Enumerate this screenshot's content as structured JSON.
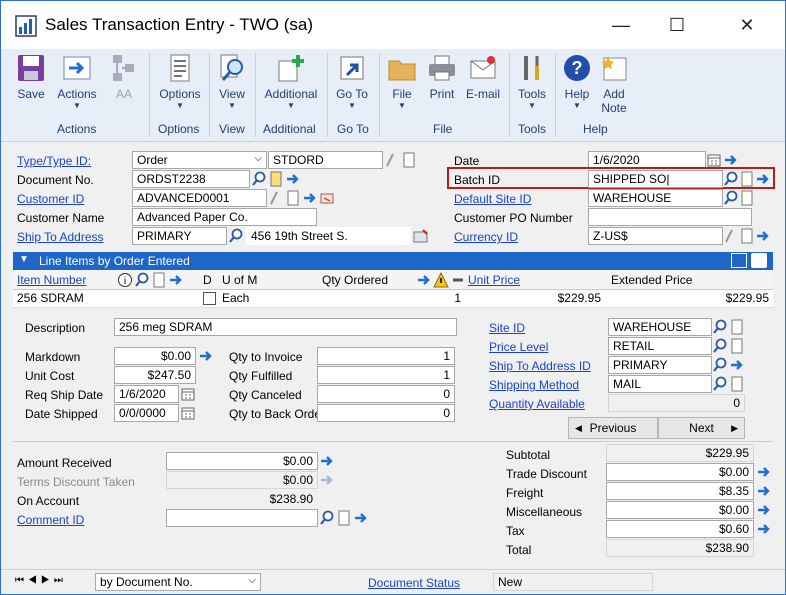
{
  "window": {
    "title": "Sales Transaction Entry  -  TWO (sa)",
    "minimize": "—",
    "maximize": "☐",
    "close": "✕"
  },
  "ribbon": {
    "buttons": [
      {
        "label": "Save",
        "icon": "save-icon"
      },
      {
        "label": "Actions",
        "icon": "actions-icon"
      },
      {
        "label": "AA",
        "icon": "aa-icon"
      },
      {
        "label": "Options",
        "icon": "options-icon"
      },
      {
        "label": "View",
        "icon": "view-icon"
      },
      {
        "label": "Additional",
        "icon": "additional-icon"
      },
      {
        "label": "Go To",
        "icon": "goto-icon"
      },
      {
        "label": "File",
        "icon": "file-icon"
      },
      {
        "label": "Print",
        "icon": "print-icon"
      },
      {
        "label": "E-mail",
        "icon": "email-icon"
      },
      {
        "label": "Tools",
        "icon": "tools-icon"
      },
      {
        "label": "Help",
        "icon": "help-icon"
      },
      {
        "label": "Add Note",
        "icon": "note-icon"
      }
    ],
    "groups": [
      "Actions",
      "Options",
      "View",
      "Additional",
      "Go To",
      "File",
      "Tools",
      "Help"
    ]
  },
  "header": {
    "type_label": "Type/Type ID:",
    "type_value": "Order",
    "type_id": "STDORD",
    "docno_label": "Document No.",
    "docno_value": "ORDST2238",
    "custid_label": "Customer ID",
    "custid_value": "ADVANCED0001",
    "custname_label": "Customer Name",
    "custname_value": "Advanced Paper Co.",
    "shipto_label": "Ship To Address",
    "shipto_value": "PRIMARY",
    "shipto_addr": "456 19th Street S.",
    "date_label": "Date",
    "date_value": "1/6/2020",
    "batch_label": "Batch ID",
    "batch_value": "SHIPPED SO|",
    "site_label": "Default Site ID",
    "site_value": "WAREHOUSE",
    "po_label": "Customer PO Number",
    "po_value": "",
    "currency_label": "Currency ID",
    "currency_value": "Z-US$"
  },
  "grid": {
    "title": "Line Items by Order Entered",
    "columns": {
      "item": "Item Number",
      "d": "D",
      "uom": "U of M",
      "qty": "Qty Ordered",
      "unit": "Unit Price",
      "ext": "Extended Price"
    },
    "row": {
      "item": "256 SDRAM",
      "uom": "Each",
      "qty": "1",
      "unit": "$229.95",
      "ext": "$229.95"
    }
  },
  "detail": {
    "desc_label": "Description",
    "desc_value": "256 meg SDRAM",
    "markdown_label": "Markdown",
    "markdown_value": "$0.00",
    "unitcost_label": "Unit Cost",
    "unitcost_value": "$247.50",
    "reqship_label": "Req Ship Date",
    "reqship_value": "1/6/2020",
    "dateship_label": "Date Shipped",
    "dateship_value": "0/0/0000",
    "qinv_label": "Qty to Invoice",
    "qinv_value": "1",
    "qful_label": "Qty Fulfilled",
    "qful_value": "1",
    "qcan_label": "Qty Canceled",
    "qcan_value": "0",
    "qbo_label": "Qty to Back Order",
    "qbo_value": "0",
    "site_label": "Site ID",
    "site_value": "WAREHOUSE",
    "price_label": "Price Level",
    "price_value": "RETAIL",
    "shipaddr_label": "Ship To Address ID",
    "shipaddr_value": "PRIMARY",
    "shipmeth_label": "Shipping Method",
    "shipmeth_value": "MAIL",
    "qavail_label": "Quantity Available",
    "qavail_value": "0",
    "prev_label": "Previous",
    "next_label": "Next"
  },
  "summary": {
    "amtrec_label": "Amount Received",
    "amtrec_value": "$0.00",
    "terms_label": "Terms Discount Taken",
    "terms_value": "$0.00",
    "onacct_label": "On Account",
    "onacct_value": "$238.90",
    "comment_label": "Comment ID",
    "comment_value": "",
    "subtotal_label": "Subtotal",
    "subtotal_value": "$229.95",
    "tradedisc_label": "Trade Discount",
    "tradedisc_value": "$0.00",
    "freight_label": "Freight",
    "freight_value": "$8.35",
    "misc_label": "Miscellaneous",
    "misc_value": "$0.00",
    "tax_label": "Tax",
    "tax_value": "$0.60",
    "total_label": "Total",
    "total_value": "$238.90"
  },
  "footer": {
    "sort_value": "by Document No.",
    "docstatus_label": "Document Status",
    "status_value": "New"
  }
}
